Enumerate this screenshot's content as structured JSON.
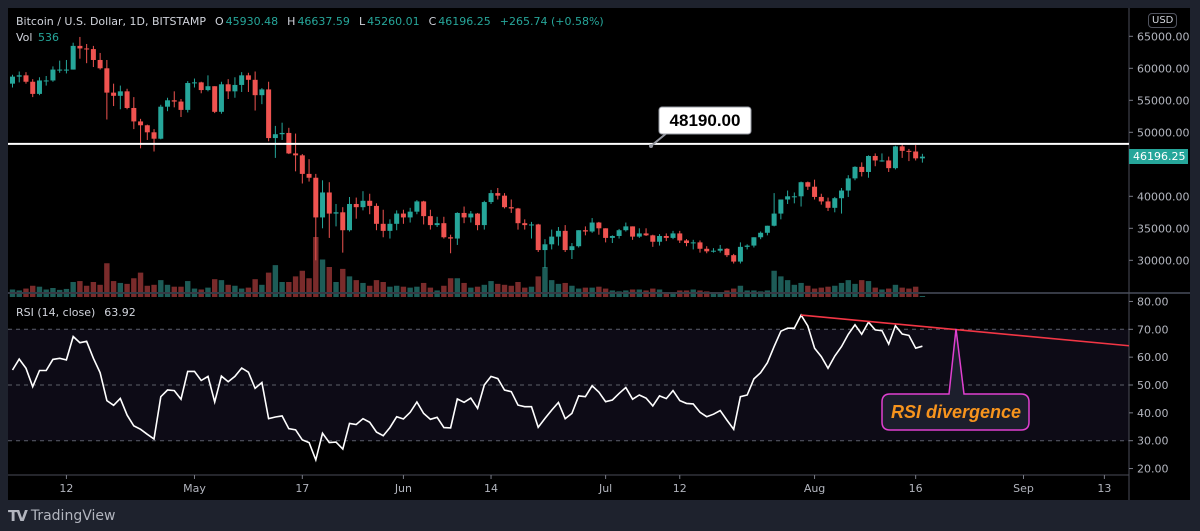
{
  "header": {
    "symbol": "Bitcoin / U.S. Dollar, 1D, BITSTAMP",
    "o_label": "O",
    "o_value": "45930.48",
    "h_label": "H",
    "h_value": "46637.59",
    "l_label": "L",
    "l_value": "45260.01",
    "c_label": "C",
    "c_value": "46196.25",
    "change": "+265.74 (+0.58%)",
    "vol_label": "Vol",
    "vol_value": "536"
  },
  "rsi_header": {
    "label": "RSI (14, close)",
    "value": "63.92"
  },
  "currency_button": "USD",
  "last_price_label": "46196.25",
  "brand": "TradingView",
  "colors": {
    "up": "#26a69a",
    "down": "#ef5350",
    "vol_up": "#1d5c57",
    "vol_down": "#7a2b2b",
    "rsi_line": "#ffffff",
    "trendline": "#f23645",
    "callout_border": "#e040d0",
    "callout_text": "#f7941d",
    "background": "#000000",
    "frame": "#1e222d"
  },
  "chart_data": [
    {
      "type": "candlestick",
      "title": "Bitcoin / U.S. Dollar, 1D, BITSTAMP",
      "ylim": [
        26000,
        66000
      ],
      "y_ticks": [
        "65000.00",
        "60000.00",
        "55000.00",
        "50000.00",
        "45000.00",
        "40000.00",
        "35000.00",
        "30000.00"
      ],
      "y_tick_values": [
        65000,
        60000,
        55000,
        50000,
        45000,
        40000,
        35000,
        30000
      ],
      "x_ticks": [
        "12",
        "May",
        "17",
        "Jun",
        "14",
        "Jul",
        "12",
        "Aug",
        "16",
        "Sep",
        "13"
      ],
      "columns": [
        "open",
        "high",
        "low",
        "close",
        "volume"
      ],
      "ohlcv": [
        [
          57600,
          59000,
          57000,
          58700,
          4000
        ],
        [
          58700,
          59500,
          57800,
          58900,
          3500
        ],
        [
          58900,
          59400,
          57600,
          57900,
          4500
        ],
        [
          57900,
          58300,
          55500,
          56000,
          6000
        ],
        [
          56000,
          58600,
          55800,
          58100,
          5500
        ],
        [
          58100,
          58800,
          57300,
          58100,
          4000
        ],
        [
          58100,
          60300,
          57900,
          59800,
          4800
        ],
        [
          59800,
          61200,
          59300,
          59800,
          3800
        ],
        [
          59800,
          61300,
          59200,
          59800,
          4300
        ],
        [
          59800,
          64000,
          59800,
          63500,
          8000
        ],
        [
          63500,
          64900,
          61500,
          63100,
          8500
        ],
        [
          63100,
          63800,
          60800,
          63000,
          6000
        ],
        [
          63000,
          63500,
          60200,
          61300,
          8000
        ],
        [
          61300,
          62400,
          59800,
          60000,
          6500
        ],
        [
          60000,
          61300,
          52000,
          56200,
          18000
        ],
        [
          56200,
          57600,
          54100,
          55700,
          8500
        ],
        [
          55700,
          57300,
          53600,
          56400,
          7500
        ],
        [
          56400,
          56800,
          53600,
          53800,
          7000
        ],
        [
          53800,
          55500,
          50500,
          51700,
          10000
        ],
        [
          51700,
          52100,
          47500,
          51100,
          13000
        ],
        [
          51100,
          51200,
          48800,
          50000,
          6000
        ],
        [
          50000,
          50500,
          47000,
          49000,
          6500
        ],
        [
          49000,
          54300,
          48900,
          54000,
          9000
        ],
        [
          54000,
          55400,
          53300,
          55000,
          6500
        ],
        [
          55000,
          56400,
          53900,
          54800,
          5500
        ],
        [
          54800,
          55200,
          52400,
          53500,
          5500
        ],
        [
          53500,
          58000,
          53100,
          57700,
          8500
        ],
        [
          57700,
          58400,
          57000,
          57800,
          4500
        ],
        [
          57800,
          57900,
          56100,
          56600,
          4000
        ],
        [
          56600,
          58900,
          56400,
          57200,
          5000
        ],
        [
          57200,
          57200,
          53000,
          53200,
          9500
        ],
        [
          53200,
          57900,
          52900,
          57500,
          9000
        ],
        [
          57500,
          58300,
          55200,
          56400,
          6500
        ],
        [
          56400,
          58600,
          55400,
          57400,
          6000
        ],
        [
          57400,
          59400,
          56300,
          58900,
          4500
        ],
        [
          58900,
          59300,
          56300,
          58200,
          5000
        ],
        [
          58200,
          59500,
          53400,
          55800,
          9500
        ],
        [
          55800,
          56900,
          54400,
          56700,
          6500
        ],
        [
          56700,
          57900,
          48600,
          49100,
          13000
        ],
        [
          49100,
          51000,
          46000,
          49700,
          17000
        ],
        [
          49700,
          51500,
          48800,
          49900,
          8000
        ],
        [
          49900,
          50700,
          46600,
          46700,
          8000
        ],
        [
          46700,
          49800,
          43900,
          46400,
          11000
        ],
        [
          46400,
          46600,
          42000,
          43500,
          14000
        ],
        [
          43500,
          45800,
          42300,
          42900,
          10000
        ],
        [
          42900,
          43500,
          30000,
          36700,
          32000
        ],
        [
          36700,
          42500,
          35000,
          40600,
          20000
        ],
        [
          40600,
          42200,
          33500,
          37300,
          16000
        ],
        [
          37300,
          38800,
          35300,
          37500,
          8000
        ],
        [
          37500,
          38300,
          31200,
          34700,
          15000
        ],
        [
          34700,
          39900,
          34500,
          38800,
          11000
        ],
        [
          38800,
          39800,
          36500,
          38300,
          9000
        ],
        [
          38300,
          40800,
          37800,
          39300,
          7500
        ],
        [
          39300,
          40400,
          37200,
          38500,
          6000
        ],
        [
          38500,
          38900,
          34700,
          35700,
          9000
        ],
        [
          35700,
          37900,
          33600,
          34600,
          8000
        ],
        [
          34600,
          36400,
          33400,
          35700,
          5500
        ],
        [
          35700,
          37800,
          34700,
          37300,
          6000
        ],
        [
          37300,
          37900,
          35700,
          36700,
          5500
        ],
        [
          36700,
          38200,
          35900,
          37600,
          5000
        ],
        [
          37600,
          39400,
          37200,
          39200,
          5500
        ],
        [
          39200,
          39300,
          35600,
          36900,
          7500
        ],
        [
          36900,
          37900,
          34800,
          35500,
          5000
        ],
        [
          35500,
          36800,
          35200,
          35800,
          3500
        ],
        [
          35800,
          36800,
          33400,
          33600,
          6000
        ],
        [
          33600,
          34000,
          31100,
          33400,
          10000
        ],
        [
          33400,
          37500,
          32400,
          37400,
          10000
        ],
        [
          37400,
          38400,
          35800,
          36700,
          7500
        ],
        [
          36700,
          37700,
          35900,
          37300,
          5000
        ],
        [
          37300,
          37400,
          34700,
          35500,
          5500
        ],
        [
          35500,
          39300,
          34800,
          39100,
          6500
        ],
        [
          39100,
          41000,
          38800,
          40500,
          8500
        ],
        [
          40500,
          41300,
          39500,
          40100,
          7000
        ],
        [
          40100,
          40500,
          38100,
          38300,
          6500
        ],
        [
          38300,
          39500,
          37400,
          38100,
          6000
        ],
        [
          38100,
          38200,
          34800,
          35800,
          8000
        ],
        [
          35800,
          36400,
          34800,
          35500,
          5000
        ],
        [
          35500,
          36000,
          33400,
          35600,
          5500
        ],
        [
          35600,
          35700,
          31300,
          31600,
          11000
        ],
        [
          31600,
          33300,
          28800,
          32500,
          16000
        ],
        [
          32500,
          34800,
          31700,
          33700,
          9000
        ],
        [
          33700,
          35200,
          32300,
          34600,
          7000
        ],
        [
          34600,
          35500,
          31300,
          31600,
          7500
        ],
        [
          31600,
          32700,
          30200,
          32200,
          6000
        ],
        [
          32200,
          34700,
          32000,
          34700,
          4500
        ],
        [
          34700,
          35300,
          33900,
          34500,
          5000
        ],
        [
          34500,
          36600,
          34300,
          35900,
          5000
        ],
        [
          35900,
          36000,
          34000,
          35000,
          5500
        ],
        [
          35000,
          35000,
          32800,
          33500,
          4500
        ],
        [
          33500,
          33900,
          32700,
          33800,
          3500
        ],
        [
          33800,
          34900,
          33400,
          34700,
          3000
        ],
        [
          34700,
          35900,
          34500,
          35300,
          3500
        ],
        [
          35300,
          35300,
          33200,
          33700,
          4000
        ],
        [
          33700,
          35000,
          33500,
          34200,
          4000
        ],
        [
          34200,
          35000,
          33800,
          33900,
          3500
        ],
        [
          33900,
          34000,
          32100,
          32900,
          4500
        ],
        [
          32900,
          34100,
          32300,
          33800,
          4000
        ],
        [
          33800,
          34200,
          33000,
          33500,
          2500
        ],
        [
          33500,
          34600,
          33300,
          34200,
          2500
        ],
        [
          34200,
          34600,
          32700,
          33100,
          3500
        ],
        [
          33100,
          33300,
          32200,
          32700,
          3500
        ],
        [
          32700,
          33200,
          31700,
          32800,
          4000
        ],
        [
          32800,
          33100,
          31200,
          31800,
          3500
        ],
        [
          31800,
          32200,
          31100,
          31400,
          3000
        ],
        [
          31400,
          31900,
          31200,
          31500,
          2500
        ],
        [
          31500,
          32400,
          31200,
          31800,
          2500
        ],
        [
          31800,
          31900,
          30500,
          30800,
          3500
        ],
        [
          30800,
          31000,
          29500,
          29800,
          4500
        ],
        [
          29800,
          32800,
          29500,
          32100,
          6000
        ],
        [
          32100,
          32500,
          31700,
          32300,
          3500
        ],
        [
          32300,
          33600,
          32000,
          33600,
          3500
        ],
        [
          33600,
          34500,
          33300,
          34300,
          3000
        ],
        [
          34300,
          35400,
          33900,
          35400,
          3500
        ],
        [
          35400,
          40500,
          35300,
          37300,
          14000
        ],
        [
          37300,
          39500,
          36400,
          39500,
          11000
        ],
        [
          39500,
          40900,
          38800,
          40000,
          9000
        ],
        [
          40000,
          40600,
          38900,
          40000,
          6500
        ],
        [
          40000,
          42300,
          38400,
          42200,
          7500
        ],
        [
          42200,
          42300,
          41000,
          41500,
          6000
        ],
        [
          41500,
          42600,
          39500,
          39900,
          4500
        ],
        [
          39900,
          40400,
          38700,
          39200,
          5000
        ],
        [
          39200,
          39800,
          37700,
          38200,
          5500
        ],
        [
          38200,
          39900,
          37500,
          39700,
          6000
        ],
        [
          39700,
          41300,
          37300,
          40900,
          7500
        ],
        [
          40900,
          43300,
          39900,
          42800,
          9000
        ],
        [
          42800,
          44700,
          42500,
          44600,
          7000
        ],
        [
          44600,
          45300,
          43100,
          43800,
          9000
        ],
        [
          43800,
          46400,
          42900,
          46300,
          8500
        ],
        [
          46300,
          46700,
          44700,
          45600,
          5000
        ],
        [
          45600,
          46700,
          45400,
          45600,
          4000
        ],
        [
          45600,
          46200,
          43800,
          44400,
          4500
        ],
        [
          44400,
          47900,
          44200,
          47800,
          6500
        ],
        [
          47800,
          48150,
          46000,
          47100,
          5000
        ],
        [
          47100,
          47400,
          45500,
          47000,
          4500
        ],
        [
          47000,
          48000,
          45600,
          45930,
          5500
        ],
        [
          45930.48,
          46637.59,
          45260.01,
          46196.25,
          536
        ]
      ],
      "horizontal_line": {
        "value": 48190,
        "label": "48190.00"
      }
    },
    {
      "type": "line",
      "title": "RSI (14, close)",
      "ylim": [
        20,
        80
      ],
      "y_ticks": [
        "80.00",
        "70.00",
        "60.00",
        "50.00",
        "40.00",
        "30.00",
        "20.00"
      ],
      "y_tick_values": [
        80,
        70,
        60,
        50,
        40,
        30,
        20
      ],
      "bands": [
        30,
        50,
        70
      ],
      "values": [
        55.4,
        59.3,
        56.0,
        49.4,
        55.2,
        55.2,
        59.2,
        59.6,
        59.0,
        67.4,
        65.2,
        65.7,
        59.6,
        54.4,
        44.4,
        42.7,
        45.2,
        39.2,
        35.3,
        34.1,
        32.3,
        30.6,
        45.8,
        48.2,
        48.0,
        44.9,
        54.9,
        54.9,
        51.6,
        53.1,
        43.9,
        53.2,
        51.2,
        53.1,
        56.1,
        54.6,
        48.8,
        50.9,
        37.9,
        38.5,
        38.9,
        34.3,
        33.9,
        30.3,
        29.3,
        23.1,
        32.7,
        29.3,
        29.5,
        27.0,
        36.2,
        35.8,
        37.9,
        36.6,
        33.1,
        31.8,
        34.7,
        38.6,
        37.8,
        40.2,
        43.9,
        39.8,
        37.7,
        38.4,
        34.7,
        34.6,
        45.0,
        43.8,
        45.3,
        41.6,
        50.0,
        53.1,
        52.3,
        48.2,
        47.6,
        42.8,
        42.2,
        42.2,
        34.8,
        38.0,
        41.0,
        43.7,
        37.9,
        39.8,
        46.1,
        45.8,
        49.7,
        47.4,
        44.0,
        44.6,
        47.0,
        49.1,
        44.9,
        46.4,
        45.3,
        42.5,
        46.1,
        45.1,
        48.0,
        44.4,
        43.4,
        43.2,
        40.2,
        38.6,
        39.5,
        40.8,
        37.4,
        34.1,
        45.8,
        46.4,
        52.2,
        54.4,
        58.0,
        63.8,
        69.3,
        70.4,
        70.4,
        75.1,
        71.2,
        63.2,
        60.2,
        56.0,
        60.4,
        63.8,
        68.2,
        71.6,
        68.2,
        72.6,
        69.8,
        69.5,
        64.7,
        71.3,
        68.3,
        67.8,
        63.2,
        63.92
      ],
      "trendline": {
        "from_value": 75.1,
        "to_value": 63.2
      },
      "annotation": "RSI divergence"
    }
  ]
}
